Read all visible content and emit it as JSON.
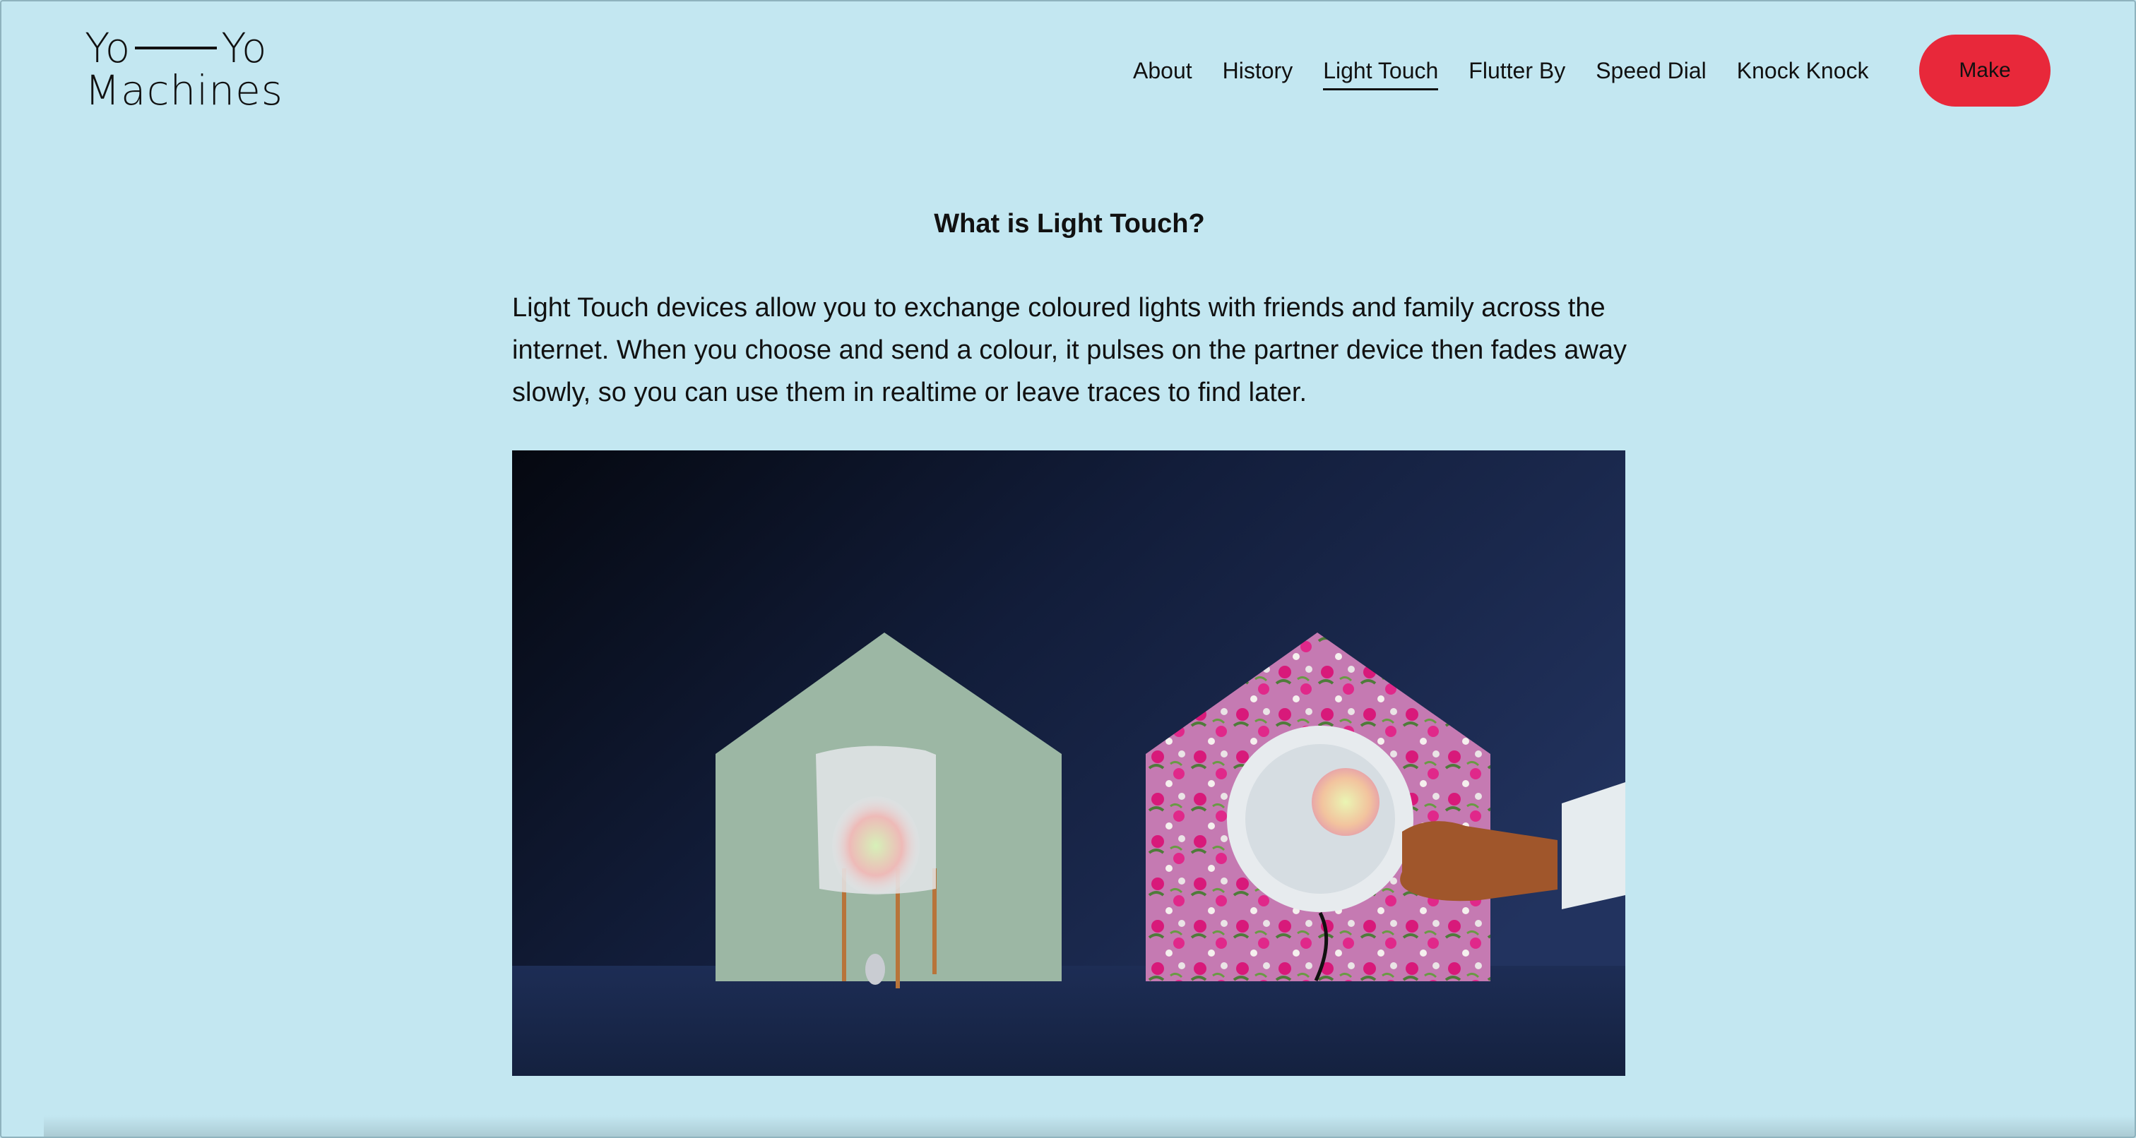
{
  "logo": {
    "line1_left": "Yo",
    "line1_right": "Yo",
    "line2": "Machines"
  },
  "nav": {
    "items": [
      {
        "label": "About",
        "active": false
      },
      {
        "label": "History",
        "active": false
      },
      {
        "label": "Light Touch",
        "active": true
      },
      {
        "label": "Flutter By",
        "active": false
      },
      {
        "label": "Speed Dial",
        "active": false
      },
      {
        "label": "Knock Knock",
        "active": false
      }
    ],
    "cta_label": "Make"
  },
  "main": {
    "heading": "What is Light Touch?",
    "paragraph": "Light Touch devices allow you to exchange coloured lights with friends and family across the internet. When you choose and send a colour, it pulses on the partner device then fades away slowly, so you can use them in realtime or leave traces to find later."
  },
  "colors": {
    "background": "#c3e7f1",
    "accent": "#e8283a",
    "text": "#111111"
  }
}
